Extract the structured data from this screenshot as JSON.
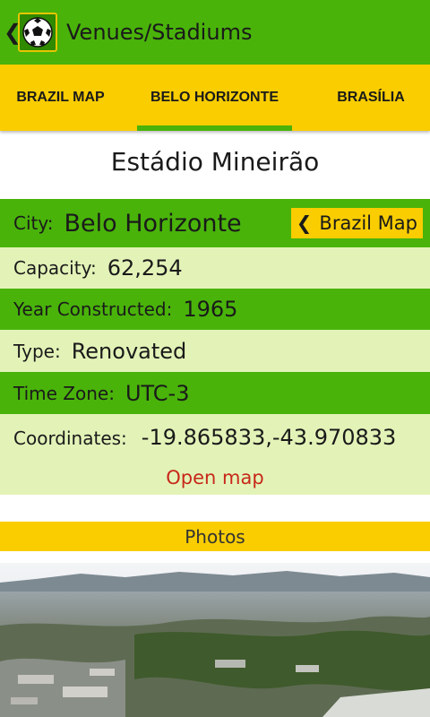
{
  "actionbar": {
    "back_icon": "chevron-left-icon",
    "app_icon": "soccer-ball-icon",
    "title": "Venues/Stadiums"
  },
  "tabs": [
    {
      "label": "BRAZIL MAP",
      "selected": false
    },
    {
      "label": "BELO HORIZONTE",
      "selected": true
    },
    {
      "label": "BRASÍLIA",
      "selected": false
    }
  ],
  "venue": {
    "name": "Estádio Mineirão"
  },
  "details": {
    "city": {
      "label": "City:",
      "value": "Belo Horizonte"
    },
    "capacity": {
      "label": "Capacity:",
      "value": "62,254"
    },
    "year": {
      "label": "Year Constructed:",
      "value": "1965"
    },
    "type": {
      "label": "Type:",
      "value": "Renovated"
    },
    "timezone": {
      "label": "Time Zone:",
      "value": "UTC-3"
    },
    "coordinates": {
      "label": "Coordinates:",
      "value": "-19.865833,-43.970833"
    }
  },
  "brazil_map_button": {
    "chevron": "❮",
    "label": "Brazil Map"
  },
  "open_map_link": "Open map",
  "photos": {
    "header": "Photos"
  },
  "colors": {
    "green": "#49b30a",
    "yellow": "#f9cd00",
    "light_green": "#e3f3b8",
    "link_red": "#c8281a"
  }
}
